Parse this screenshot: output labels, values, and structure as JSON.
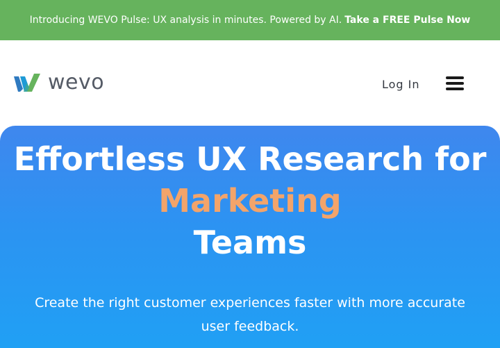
{
  "announcement": {
    "text": "Introducing WEVO Pulse: UX analysis in minutes. Powered by AI.",
    "cta": "Take a FREE Pulse Now"
  },
  "header": {
    "logo_text": "wevo",
    "login_label": "Log In",
    "menu_icon": "hamburger-menu-icon"
  },
  "hero": {
    "title_line1": "Effortless UX Research for",
    "title_accent": "Marketing",
    "title_line3": "Teams",
    "subtitle": "Create the right customer experiences faster with more accurate user feedback."
  },
  "colors": {
    "announcement_bg": "#66b35d",
    "hero_gradient_top": "#3f87ee",
    "hero_gradient_bottom": "#20a0f4",
    "accent": "#f3a46a"
  }
}
